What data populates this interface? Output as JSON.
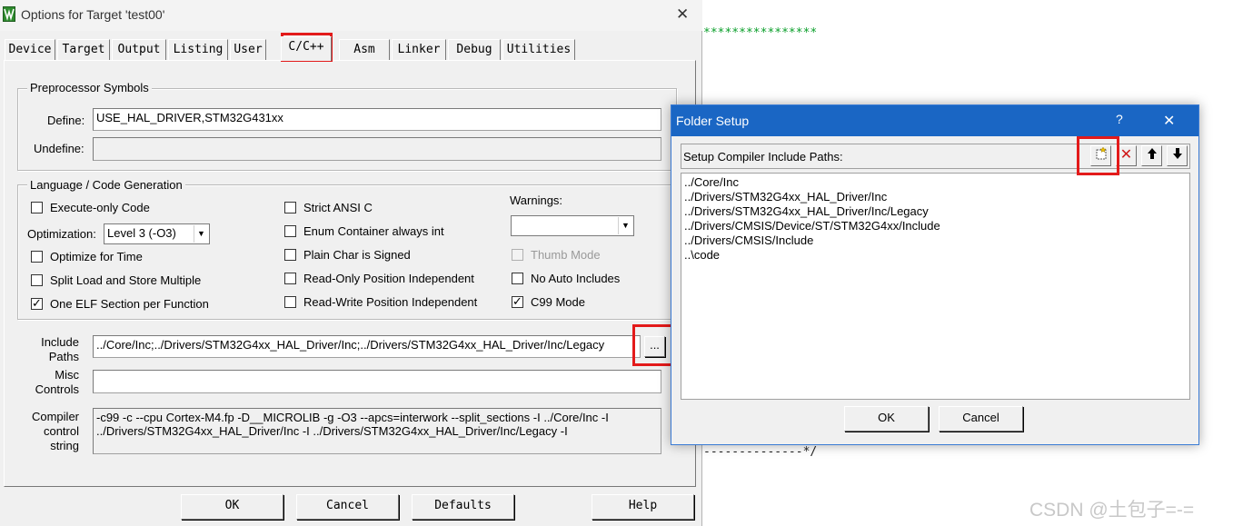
{
  "editor": {
    "asterisks": "****************",
    "dashes": "--------------*/"
  },
  "options_dialog": {
    "title": "Options for Target 'test00'",
    "close_glyph": "✕",
    "tabs": [
      "Device",
      "Target",
      "Output",
      "Listing",
      "User",
      "C/C++",
      "Asm",
      "Linker",
      "Debug",
      "Utilities"
    ],
    "preprocessor": {
      "title": "Preprocessor Symbols",
      "define_label": "Define:",
      "define_value": "USE_HAL_DRIVER,STM32G431xx",
      "undefine_label": "Undefine:",
      "undefine_value": ""
    },
    "language": {
      "title": "Language / Code Generation",
      "execute_only": "Execute-only Code",
      "optimization_label": "Optimization:",
      "optimization_value": "Level 3 (-O3)",
      "optimize_time": "Optimize for Time",
      "split_load": "Split Load and Store Multiple",
      "one_elf": "One ELF Section per Function",
      "strict_ansi": "Strict ANSI C",
      "enum_container": "Enum Container always int",
      "plain_char": "Plain Char is Signed",
      "ro_pi": "Read-Only Position Independent",
      "rw_pi": "Read-Write Position Independent",
      "warnings_label": "Warnings:",
      "warnings_value": "",
      "thumb_mode": "Thumb Mode",
      "no_auto_includes": "No Auto Includes",
      "c99_mode": "C99 Mode",
      "check_glyph": "✓"
    },
    "include": {
      "label_1": "Include",
      "label_2": "Paths",
      "value": "../Core/Inc;../Drivers/STM32G4xx_HAL_Driver/Inc;../Drivers/STM32G4xx_HAL_Driver/Inc/Legacy",
      "browse_label": "..."
    },
    "misc": {
      "label_1": "Misc",
      "label_2": "Controls",
      "value": ""
    },
    "compiler": {
      "label_1": "Compiler",
      "label_2": "control",
      "label_3": "string",
      "line_1": "-c99 -c --cpu Cortex-M4.fp -D__MICROLIB -g -O3 --apcs=interwork --split_sections -I ../Core/Inc -I",
      "line_2": "../Drivers/STM32G4xx_HAL_Driver/Inc -I ../Drivers/STM32G4xx_HAL_Driver/Inc/Legacy -I"
    },
    "buttons": {
      "ok": "OK",
      "cancel": "Cancel",
      "defaults": "Defaults",
      "help": "Help"
    }
  },
  "folder_setup": {
    "title": "Folder Setup",
    "help_glyph": "?",
    "close_glyph": "✕",
    "header_label": "Setup Compiler Include Paths:",
    "delete_glyph": "✕",
    "up_glyph": "🡅",
    "down_glyph": "🡇",
    "paths": [
      "../Core/Inc",
      "../Drivers/STM32G4xx_HAL_Driver/Inc",
      "../Drivers/STM32G4xx_HAL_Driver/Inc/Legacy",
      "../Drivers/CMSIS/Device/ST/STM32G4xx/Include",
      "../Drivers/CMSIS/Include",
      "..\\code"
    ],
    "ok": "OK",
    "cancel": "Cancel"
  },
  "watermark": "CSDN @土包子=-=",
  "colors": {
    "highlight": "#e31a1a",
    "titlebar": "#1a66c4",
    "code_green": "#0a9f2a"
  }
}
